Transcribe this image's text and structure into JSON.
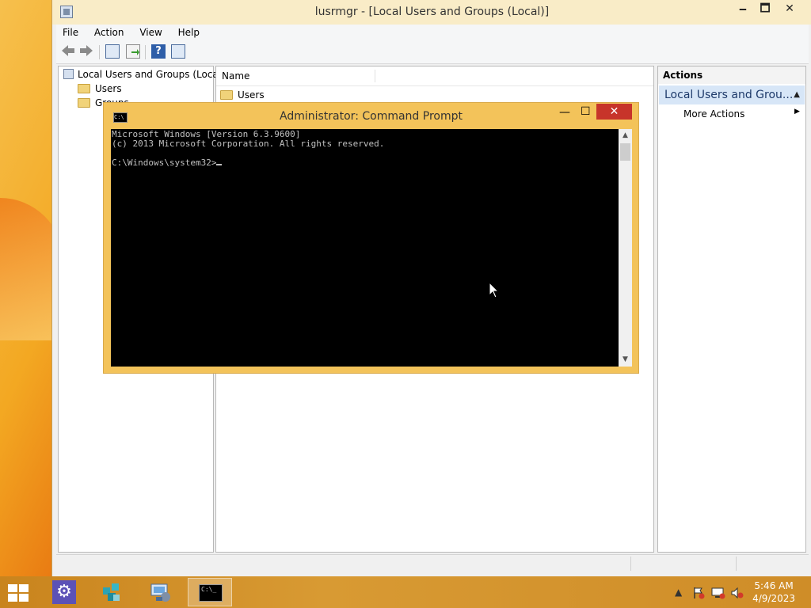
{
  "window": {
    "title": "lusrmgr - [Local Users and Groups (Local)]",
    "min_glyph": "🗕",
    "max_glyph": "🗖",
    "close_glyph": "✕"
  },
  "menu": [
    "File",
    "Action",
    "View",
    "Help"
  ],
  "toolbar": {
    "icons": [
      "back-arrow-icon",
      "forward-arrow-icon",
      "show-hide-tree-icon",
      "export-list-icon",
      "help-icon",
      "show-hide-action-pane-icon"
    ]
  },
  "tree": {
    "root": "Local Users and Groups (Local)",
    "items": [
      "Users",
      "Groups"
    ]
  },
  "list": {
    "column": "Name",
    "rows": [
      "Users"
    ]
  },
  "actions": {
    "header": "Actions",
    "section": "Local Users and Grou...",
    "item": "More Actions"
  },
  "cmd": {
    "title": "Administrator:  Command Prompt",
    "icon_text": "C:\\",
    "lines": [
      "Microsoft Windows [Version 6.3.9600]",
      "(c) 2013 Microsoft Corporation. All rights reserved.",
      "",
      "C:\\Windows\\system32>"
    ],
    "close_glyph": "✕",
    "min_glyph": "—",
    "max_glyph": "☐"
  },
  "taskbar": {
    "apps": [
      "settings-icon",
      "network-setup-icon",
      "computer-management-icon",
      "command-prompt-icon"
    ],
    "clock_time": "5:46 AM",
    "clock_date": "4/9/2023"
  },
  "colors": {
    "titlebar": "#f9ecc7",
    "cmd_frame": "#f3c35a",
    "close_red": "#c7342a",
    "actions_highlight": "#d7e6f7",
    "taskbar": "#d89a33"
  }
}
